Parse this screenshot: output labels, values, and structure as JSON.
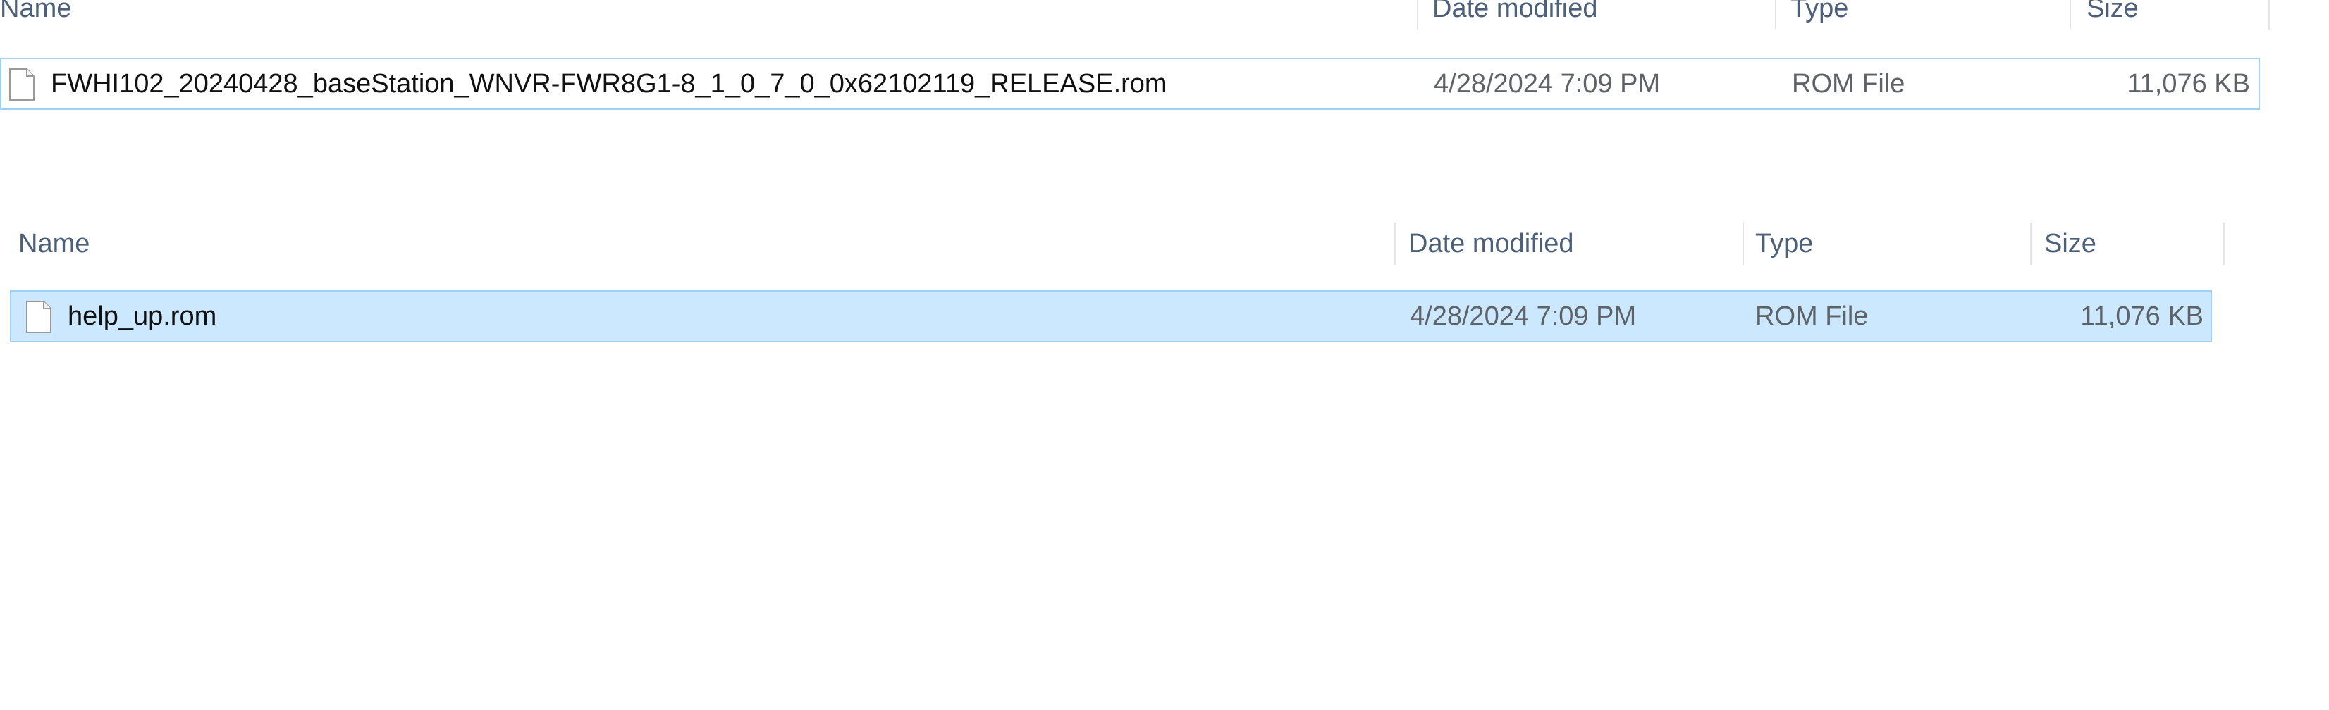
{
  "columns": {
    "name": "Name",
    "date_modified": "Date modified",
    "type": "Type",
    "size": "Size"
  },
  "top_list": {
    "files": [
      {
        "name": "FWHI102_20240428_baseStation_WNVR-FWR8G1-8_1_0_7_0_0x62102119_RELEASE.rom",
        "date_modified": "4/28/2024 7:09 PM",
        "type": "ROM File",
        "size": "11,076 KB",
        "icon": "file-icon"
      }
    ]
  },
  "bottom_list": {
    "files": [
      {
        "name": "help_up.rom",
        "date_modified": "4/28/2024 7:09 PM",
        "type": "ROM File",
        "size": "11,076 KB",
        "icon": "file-icon",
        "selected": true
      }
    ]
  },
  "colors": {
    "selection_fill": "#cce8ff",
    "selection_border": "#9fd0f4",
    "header_text": "#4c607a"
  }
}
